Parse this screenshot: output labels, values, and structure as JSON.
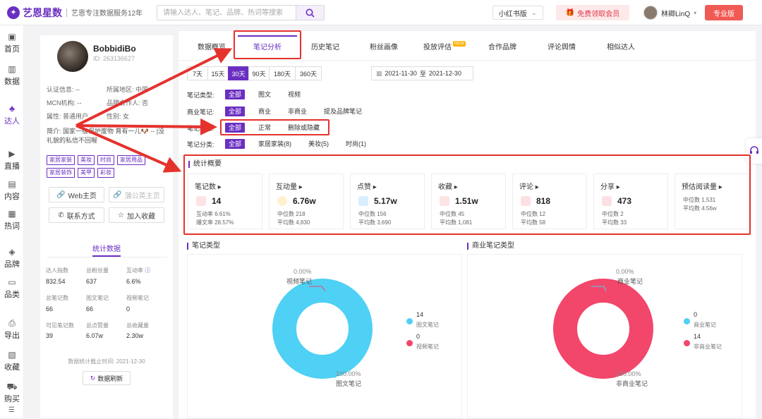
{
  "header": {
    "brand": "艺恩星数",
    "slogan": "艺恩专注数据服务12年",
    "search_placeholder": "请输入达人、笔记、品牌、热词等搜索",
    "platform": "小红书版",
    "vip_cta": "免费领取会员",
    "user_name": "林卿LinQ",
    "pro_label": "专业版"
  },
  "nav": [
    {
      "label": "首页",
      "icon": "home-icon"
    },
    {
      "label": "数据",
      "icon": "chart-icon"
    },
    {
      "label": "达人",
      "icon": "people-icon"
    },
    {
      "label": "直播",
      "icon": "live-icon"
    },
    {
      "label": "内容",
      "icon": "content-icon"
    },
    {
      "label": "热词",
      "icon": "hotword-icon"
    },
    {
      "label": "品牌",
      "icon": "brand-icon"
    },
    {
      "label": "品类",
      "icon": "category-icon"
    },
    {
      "label": "导出",
      "icon": "export-icon"
    },
    {
      "label": "收藏",
      "icon": "bookmark-icon"
    },
    {
      "label": "购买",
      "icon": "cart-icon"
    }
  ],
  "profile": {
    "name": "BobbidiBo",
    "id": "ID: 263136627",
    "cert": "认证信息: --",
    "region": "所属地区: 中国",
    "mcn": "MCN机构: --",
    "partner": "品牌合作人: 否",
    "attr": "属性: 普通用户",
    "gender": "性别: 女",
    "intro": "简介: 国家一级保护废物 育有一儿🐶 -- |没礼貌的私信不回喔",
    "tags": [
      "家居家装",
      "美妆",
      "时尚",
      "家居用品",
      "家居装饰",
      "美甲",
      "彩妆"
    ],
    "web_btn": "Web主页",
    "pugongying_btn": "蒲公英主页",
    "contact_btn": "联系方式",
    "fav_btn": "加入收藏",
    "stats_title": "统计数据",
    "stats": [
      {
        "label": "达人指数",
        "value": "832.54"
      },
      {
        "label": "总粉丝量",
        "value": "637"
      },
      {
        "label": "互动率",
        "value": "6.6%"
      },
      {
        "label": "总笔记数",
        "value": "66"
      },
      {
        "label": "图文笔记",
        "value": "66"
      },
      {
        "label": "视频笔记",
        "value": "0"
      },
      {
        "label": "可见笔记数",
        "value": "39"
      },
      {
        "label": "总点赞量",
        "value": "6.07w"
      },
      {
        "label": "总收藏量",
        "value": "2.30w"
      }
    ],
    "deadline": "数据统计截止时间: 2021-12-30",
    "refresh_btn": "数据刷新"
  },
  "tabs": [
    "数据概览",
    "笔记分析",
    "历史笔记",
    "粉丝画像",
    "投放评估",
    "合作品牌",
    "评论舆情",
    "相似达人"
  ],
  "tab_new_badge": "NEW",
  "ranges": [
    "7天",
    "15天",
    "30天",
    "90天",
    "180天",
    "360天"
  ],
  "date_from": "2021-11-30",
  "date_to_word": "至",
  "date_to": "2021-12-30",
  "filters": {
    "type": {
      "label": "笔记类型:",
      "options": [
        "全部",
        "图文",
        "视频"
      ]
    },
    "commercial": {
      "label": "商业笔记:",
      "options": [
        "全部",
        "商业",
        "非商业",
        "提及品牌笔记"
      ]
    },
    "status": {
      "label": "笔记状态:",
      "options": [
        "全部",
        "正常",
        "删除或隐藏"
      ]
    },
    "category": {
      "label": "笔记分类:",
      "options": [
        "全部",
        "家居家装(8)",
        "美妆(5)",
        "时尚(1)"
      ]
    }
  },
  "overview": {
    "title": "统计概要",
    "cards": [
      {
        "title": "笔记数",
        "value": "14",
        "sub1": "互动率 6.61%",
        "sub2": "爆文率 28.57%",
        "color": "#f25a6a"
      },
      {
        "title": "互动量",
        "value": "6.76w",
        "sub1": "中位数 218",
        "sub2": "平均数 4,830",
        "color": "#ffc94a"
      },
      {
        "title": "点赞",
        "value": "5.17w",
        "sub1": "中位数 156",
        "sub2": "平均数 3,690",
        "color": "#3bb3f5"
      },
      {
        "title": "收藏",
        "value": "1.51w",
        "sub1": "中位数 45",
        "sub2": "平均数 1,081",
        "color": "#f26a6a"
      },
      {
        "title": "评论",
        "value": "818",
        "sub1": "中位数 12",
        "sub2": "平均数 58",
        "color": "#f24d5e"
      },
      {
        "title": "分享",
        "value": "473",
        "sub1": "中位数 2",
        "sub2": "平均数 33",
        "color": "#f24d5e"
      },
      {
        "title": "预估阅读量",
        "value": "",
        "sub1": "中位数 1,531",
        "sub2": "平均数 4.56w",
        "color": ""
      }
    ]
  },
  "charts": {
    "note_type": {
      "title": "笔记类型",
      "top_pct": "0.00%",
      "top_label": "视频笔记",
      "bottom_pct": "100.00%",
      "bottom_label": "图文笔记",
      "legend": [
        {
          "value": "14",
          "name": "图文笔记",
          "color": "#4fd0f5"
        },
        {
          "value": "0",
          "name": "视频笔记",
          "color": "#f2466a"
        }
      ]
    },
    "commercial_type": {
      "title": "商业笔记类型",
      "top_pct": "0.00%",
      "top_label": "商业笔记",
      "bottom_pct": "100.00%",
      "bottom_label": "非商业笔记",
      "legend": [
        {
          "value": "0",
          "name": "商业笔记",
          "color": "#4fd0f5"
        },
        {
          "value": "14",
          "name": "非商业笔记",
          "color": "#f2466a"
        }
      ]
    }
  },
  "chart_data": [
    {
      "type": "pie",
      "title": "笔记类型",
      "categories": [
        "图文笔记",
        "视频笔记"
      ],
      "values": [
        14,
        0
      ]
    },
    {
      "type": "pie",
      "title": "商业笔记类型",
      "categories": [
        "商业笔记",
        "非商业笔记"
      ],
      "values": [
        0,
        14
      ]
    }
  ],
  "colors": {
    "accent": "#6a2fc1",
    "annotation": "#e5322d"
  }
}
